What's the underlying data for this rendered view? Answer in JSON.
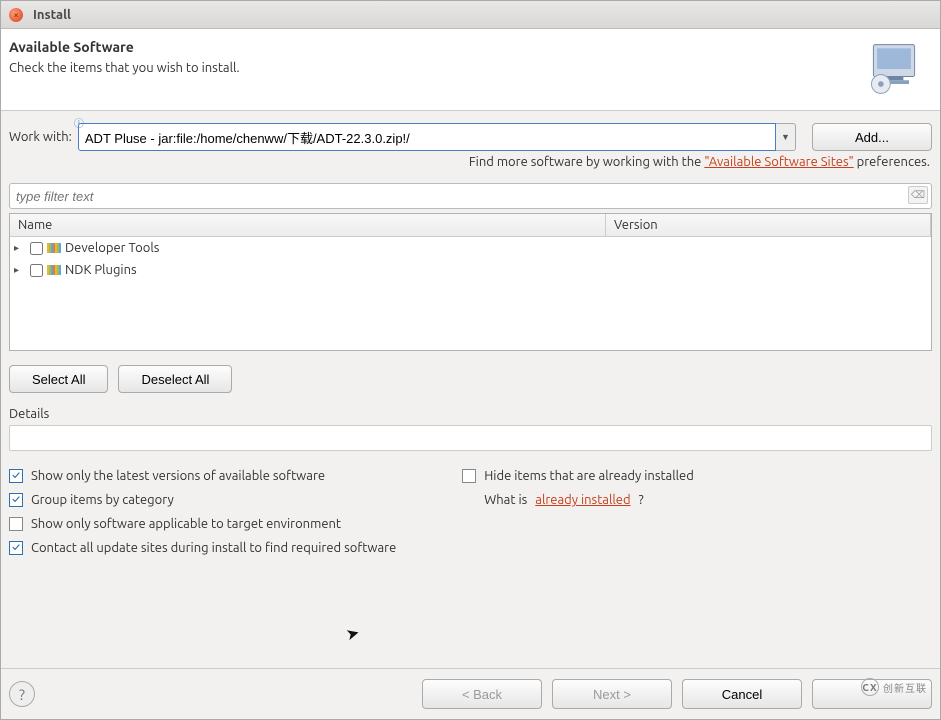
{
  "titlebar": {
    "title": "Install"
  },
  "header": {
    "title": "Available Software",
    "subtitle": "Check the items that you wish to install."
  },
  "workwith": {
    "label": "Work with:",
    "value": "ADT Pluse - jar:file:/home/chenww/下载/ADT-22.3.0.zip!/",
    "add_label": "Add..."
  },
  "hint": {
    "prefix": "Find more software by working with the ",
    "link_text": "\"Available Software Sites\"",
    "suffix": " preferences."
  },
  "filter": {
    "placeholder": "type filter text"
  },
  "tree": {
    "col_name": "Name",
    "col_version": "Version",
    "rows": [
      {
        "label": "Developer Tools",
        "checked": false
      },
      {
        "label": "NDK Plugins",
        "checked": false
      }
    ]
  },
  "buttons": {
    "select_all": "Select All",
    "deselect_all": "Deselect All"
  },
  "details": {
    "label": "Details"
  },
  "options": {
    "show_latest": {
      "label": "Show only the latest versions of available software",
      "checked": true
    },
    "group_category": {
      "label": "Group items by category",
      "checked": true
    },
    "applicable": {
      "label": "Show only software applicable to target environment",
      "checked": false
    },
    "contact_sites": {
      "label": "Contact all update sites during install to find required software",
      "checked": true
    },
    "hide_installed": {
      "label": "Hide items that are already installed",
      "checked": false
    },
    "whatis_prefix": "What is ",
    "whatis_link": "already installed",
    "whatis_suffix": "?"
  },
  "nav": {
    "back": "< Back",
    "next": "Next >",
    "cancel": "Cancel",
    "finish": ""
  },
  "watermark": {
    "text": "创新互联"
  }
}
